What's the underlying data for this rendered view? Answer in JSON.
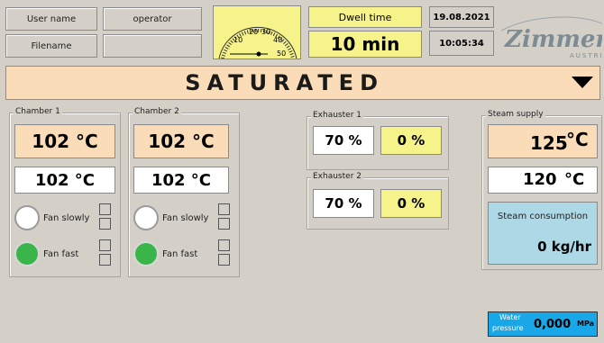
{
  "header": {
    "user_name_label": "User name",
    "user_name_value": "operator",
    "filename_label": "Filename",
    "filename_value": "",
    "gauge_ticks": [
      "10",
      "20",
      "30",
      "40",
      "50"
    ],
    "dwell_label": "Dwell time",
    "dwell_value": "10 min",
    "date": "19.08.2021",
    "time": "10:05:34",
    "logo_text": "Zimmer",
    "logo_sub": "AUSTRIA"
  },
  "banner": {
    "mode": "SATURATED"
  },
  "chamber1": {
    "title": "Chamber 1",
    "setpoint": "102 °C",
    "actual": "102 °C",
    "fan_slowly_label": "Fan slowly",
    "fan_fast_label": "Fan fast",
    "fan_slowly_on": false,
    "fan_fast_on": true
  },
  "chamber2": {
    "title": "Chamber 2",
    "setpoint": "102 °C",
    "actual": "102 °C",
    "fan_slowly_label": "Fan slowly",
    "fan_fast_label": "Fan fast",
    "fan_slowly_on": false,
    "fan_fast_on": true
  },
  "exhauster1": {
    "title": "Exhauster 1",
    "setpoint": "70 %",
    "actual": "0 %"
  },
  "exhauster2": {
    "title": "Exhauster 2",
    "setpoint": "70 %",
    "actual": "0 %"
  },
  "steam": {
    "title": "Steam supply",
    "setpoint_value": "125",
    "setpoint_unit": "°C",
    "actual_value": "120",
    "actual_unit": "°C",
    "consumption_label": "Steam consumption",
    "consumption_value": "0 kg/hr"
  },
  "water": {
    "label_line1": "Water",
    "label_line2": "pressure",
    "value": "0,000",
    "unit": "MPa"
  },
  "colors": {
    "peach": "#fbdcb9",
    "yellow": "#f6f38a",
    "green": "#39b54a",
    "cyan": "#add8e6",
    "water_blue": "#1aa7e8"
  }
}
